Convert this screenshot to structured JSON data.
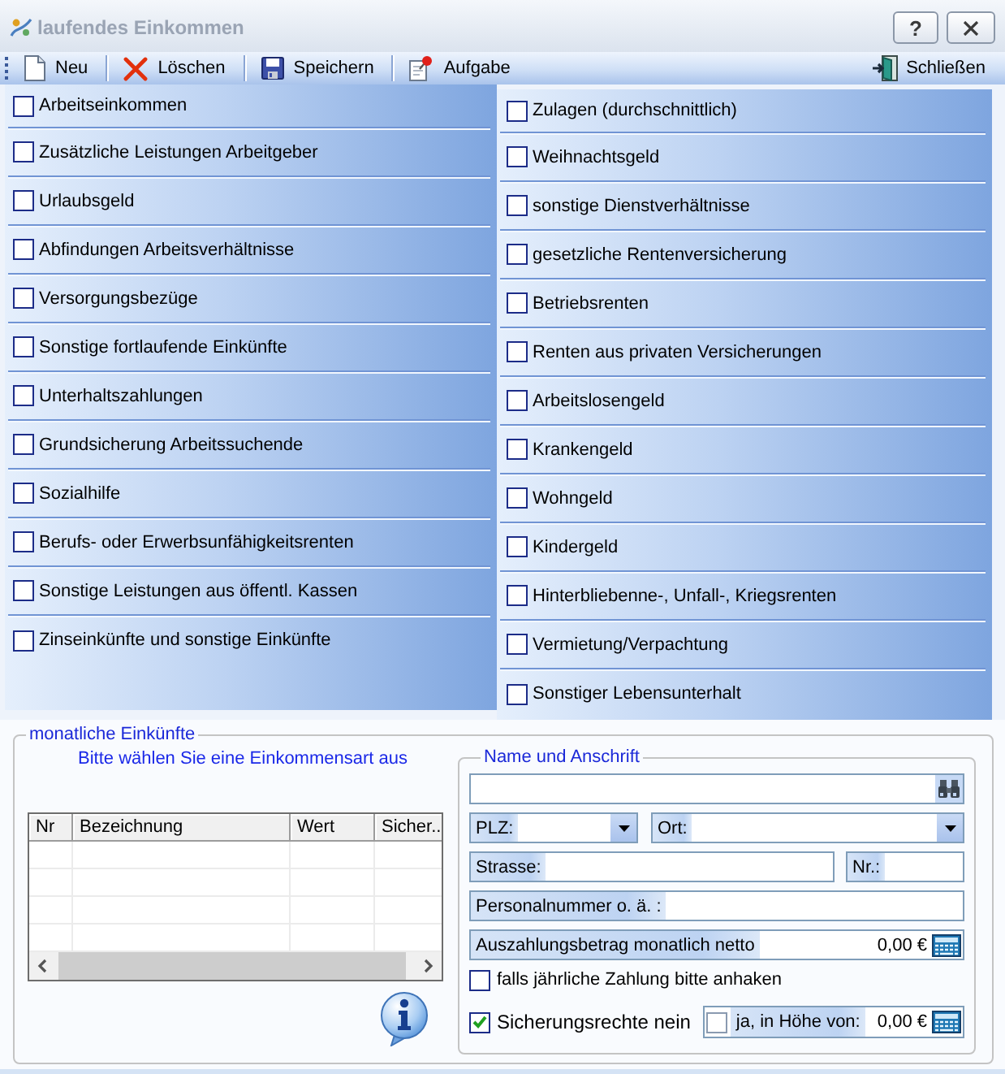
{
  "window": {
    "title": "laufendes Einkommen",
    "help_button": "?"
  },
  "toolbar": {
    "new": "Neu",
    "delete": "Löschen",
    "save": "Speichern",
    "task": "Aufgabe",
    "close": "Schließen"
  },
  "income_types": {
    "left": [
      {
        "label": "Arbeitseinkommen",
        "checked": false
      },
      {
        "label": "Zusätzliche Leistungen Arbeitgeber",
        "checked": false
      },
      {
        "label": "Urlaubsgeld",
        "checked": false
      },
      {
        "label": "Abfindungen Arbeitsverhältnisse",
        "checked": false
      },
      {
        "label": "Versorgungsbezüge",
        "checked": false
      },
      {
        "label": "Sonstige fortlaufende Einkünfte",
        "checked": false
      },
      {
        "label": "Unterhaltszahlungen",
        "checked": false
      },
      {
        "label": "Grundsicherung Arbeitssuchende",
        "checked": false
      },
      {
        "label": "Sozialhilfe",
        "checked": false
      },
      {
        "label": "Berufs- oder Erwerbsunfähigkeitsrenten",
        "checked": false
      },
      {
        "label": "Sonstige Leistungen aus öffentl. Kassen",
        "checked": false
      },
      {
        "label": "Zinseinkünfte und sonstige Einkünfte",
        "checked": false
      }
    ],
    "right": [
      {
        "label": "Zulagen (durchschnittlich)",
        "checked": false
      },
      {
        "label": "Weihnachtsgeld",
        "checked": false
      },
      {
        "label": "sonstige Dienstverhältnisse",
        "checked": false
      },
      {
        "label": "gesetzliche Rentenversicherung",
        "checked": false
      },
      {
        "label": "Betriebsrenten",
        "checked": false
      },
      {
        "label": "Renten aus privaten Versicherungen",
        "checked": false
      },
      {
        "label": "Arbeitslosengeld",
        "checked": false
      },
      {
        "label": "Krankengeld",
        "checked": false
      },
      {
        "label": "Wohngeld",
        "checked": false
      },
      {
        "label": "Kindergeld",
        "checked": false
      },
      {
        "label": "Hinterbliebenne-, Unfall-, Kriegsrenten",
        "checked": false
      },
      {
        "label": "Vermietung/Verpachtung",
        "checked": false
      },
      {
        "label": "Sonstiger Lebensunterhalt",
        "checked": false
      }
    ]
  },
  "monthly_income": {
    "title": "monatliche Einkünfte",
    "hint": "Bitte wählen Sie eine Einkommensart aus",
    "table": {
      "columns": [
        "Nr",
        "Bezeichnung",
        "Wert",
        "Sicher.."
      ]
    }
  },
  "address": {
    "title": "Name und Anschrift",
    "plz_label": "PLZ:",
    "city_label": "Ort:",
    "street_label": "Strasse:",
    "house_number_label": "Nr.:",
    "personnel_number_label": "Personalnummer o. ä. :",
    "net_payout": {
      "label": "Auszahlungsbetrag monatlich netto",
      "value": "0,00 €"
    },
    "annual_payment": {
      "label": "falls jährliche Zahlung bitte anhaken",
      "checked": false
    },
    "no_security_rights": {
      "label": "Sicherungsrechte nein",
      "checked": true
    },
    "security_amount": {
      "label": "ja, in Höhe von:",
      "checked": false,
      "value": "0,00 €"
    }
  }
}
